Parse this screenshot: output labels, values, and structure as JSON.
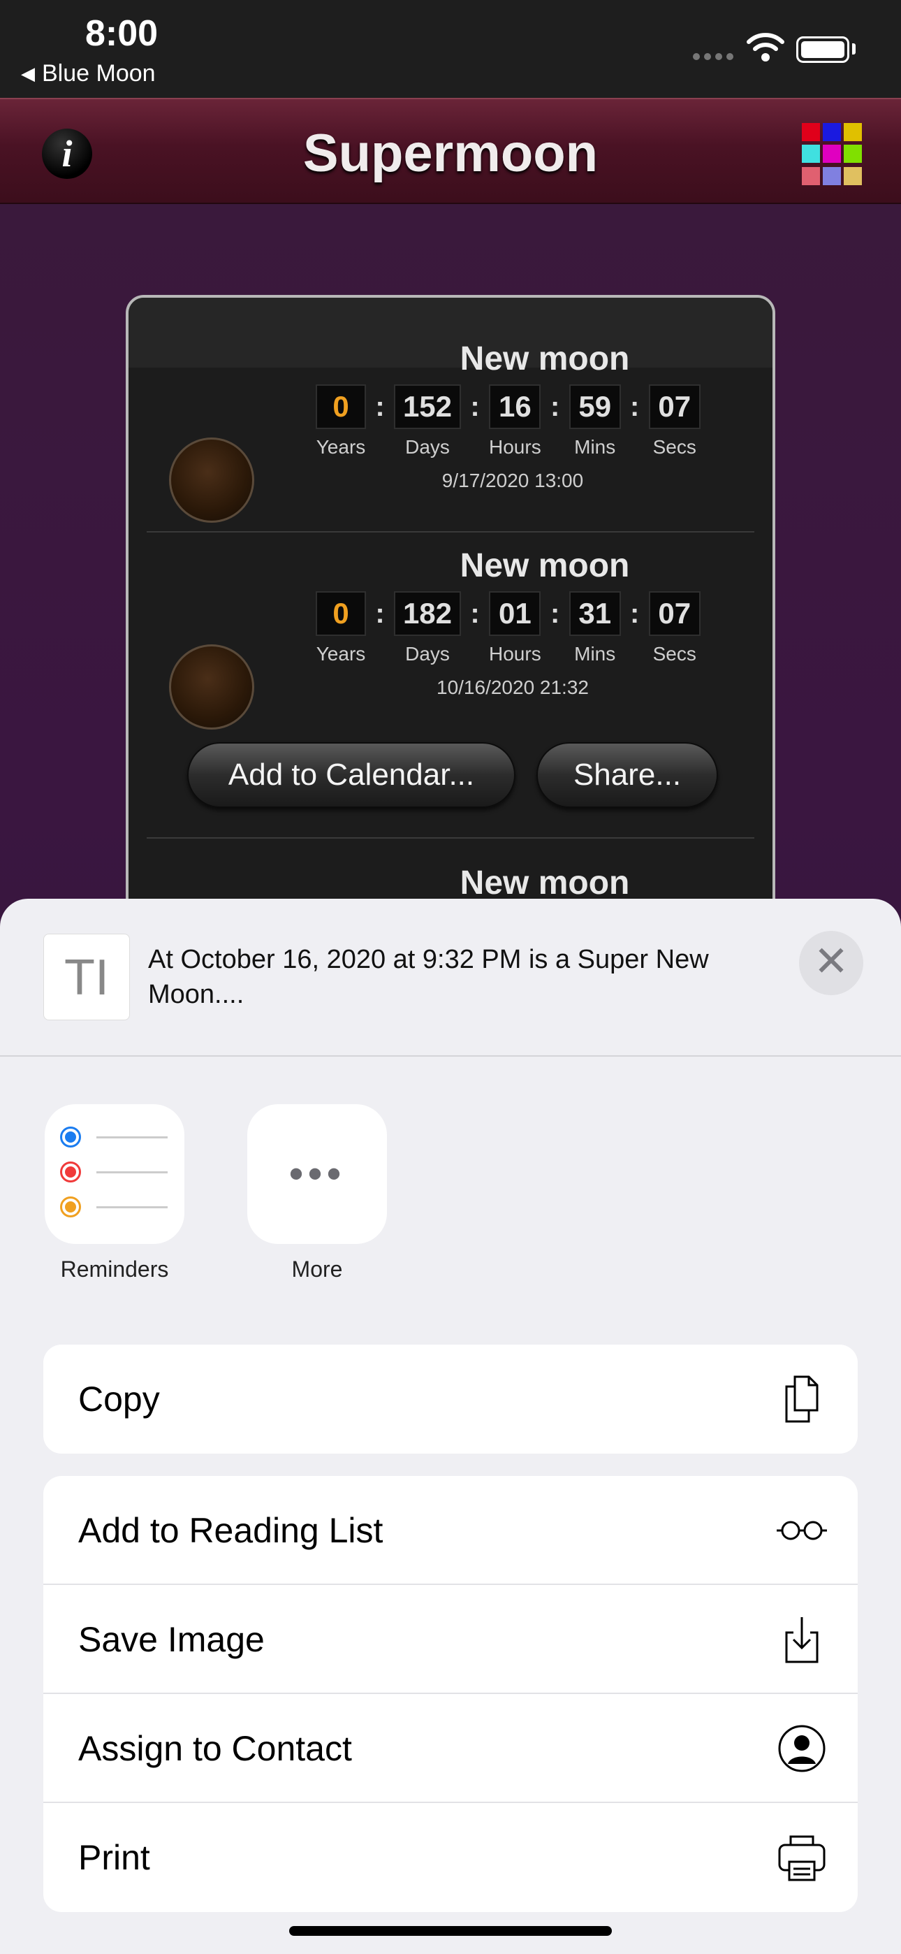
{
  "status_bar": {
    "time": "8:00",
    "back_app": "Blue Moon"
  },
  "nav": {
    "title": "Supermoon",
    "info_label": "i"
  },
  "grid_colors": [
    "#e0001a",
    "#1a1ae0",
    "#e0c000",
    "#40e0e0",
    "#e000c0",
    "#80e000",
    "#e06070",
    "#8080e0",
    "#e0c060"
  ],
  "events": [
    {
      "title": "New moon",
      "counter": {
        "years": "0",
        "days": "152",
        "hours": "16",
        "mins": "59",
        "secs": "07"
      },
      "datetime": "9/17/2020  13:00"
    },
    {
      "title": "New moon",
      "counter": {
        "years": "0",
        "days": "182",
        "hours": "01",
        "mins": "31",
        "secs": "07"
      },
      "datetime": "10/16/2020  21:32"
    },
    {
      "title": "New moon"
    }
  ],
  "units": {
    "years": "Years",
    "days": "Days",
    "hours": "Hours",
    "mins": "Mins",
    "secs": "Secs"
  },
  "buttons": {
    "add_calendar": "Add to Calendar...",
    "share": "Share..."
  },
  "share_sheet": {
    "preview_text": "At October 16, 2020 at 9:32 PM is a Super New Moon....",
    "apps": [
      {
        "label": "Reminders"
      },
      {
        "label": "More"
      }
    ],
    "actions_group1": [
      {
        "label": "Copy",
        "icon": "copy-icon"
      }
    ],
    "actions_group2": [
      {
        "label": "Add to Reading List",
        "icon": "glasses-icon"
      },
      {
        "label": "Save Image",
        "icon": "save-icon"
      },
      {
        "label": "Assign to Contact",
        "icon": "contact-icon"
      },
      {
        "label": "Print",
        "icon": "printer-icon"
      }
    ]
  }
}
